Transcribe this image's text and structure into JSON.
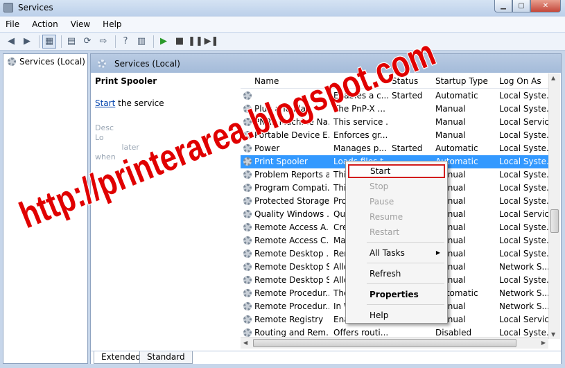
{
  "window": {
    "title": "Services"
  },
  "menu": [
    "File",
    "Action",
    "View",
    "Help"
  ],
  "tree": {
    "root": "Services (Local)"
  },
  "pane": {
    "header": "Services (Local)",
    "selected_service": "Print Spooler",
    "action_link": "Start",
    "action_suffix": " the service",
    "faded_text": "Desc\nLo\n           later\nwhen"
  },
  "columns": [
    "Name",
    "Status",
    "Startup Type",
    "Log On As"
  ],
  "rows": [
    {
      "name": "",
      "desc": "Enables a c...",
      "status": "Started",
      "startup": "Automatic",
      "logon": "Local Syste..."
    },
    {
      "name": "Plug and Play",
      "desc": "The PnP-X ...",
      "status": "",
      "startup": "Manual",
      "logon": "Local Syste..."
    },
    {
      "name": "PNRP Machine Na...",
      "desc": "This service ...",
      "status": "",
      "startup": "Manual",
      "logon": "Local Service"
    },
    {
      "name": "Portable Device E...",
      "desc": "Enforces gr...",
      "status": "",
      "startup": "Manual",
      "logon": "Local Syste..."
    },
    {
      "name": "Power",
      "desc": "Manages p...",
      "status": "Started",
      "startup": "Automatic",
      "logon": "Local Syste..."
    },
    {
      "name": "Print Spooler",
      "desc": "Loads files t...",
      "status": "",
      "startup": "Automatic",
      "logon": "Local Syste..."
    },
    {
      "name": "Problem Reports a...",
      "desc": "This ...",
      "status": "",
      "startup": "Manual",
      "logon": "Local Syste..."
    },
    {
      "name": "Program Compati...",
      "desc": "This ...",
      "status": "",
      "startup": "Manual",
      "logon": "Local Syste..."
    },
    {
      "name": "Protected Storage",
      "desc": "Prov...",
      "status": "",
      "startup": "Manual",
      "logon": "Local Syste..."
    },
    {
      "name": "Quality Windows ...",
      "desc": "Qual...",
      "status": "",
      "startup": "Manual",
      "logon": "Local Service"
    },
    {
      "name": "Remote Access A...",
      "desc": "Crea...",
      "status": "",
      "startup": "Manual",
      "logon": "Local Syste..."
    },
    {
      "name": "Remote Access C...",
      "desc": "Man...",
      "status": "",
      "startup": "Manual",
      "logon": "Local Syste..."
    },
    {
      "name": "Remote Desktop ...",
      "desc": "Rem...",
      "status": "",
      "startup": "Manual",
      "logon": "Local Syste..."
    },
    {
      "name": "Remote Desktop S...",
      "desc": "Allo...",
      "status": "",
      "startup": "Manual",
      "logon": "Network S..."
    },
    {
      "name": "Remote Desktop S...",
      "desc": "Allo...",
      "status": "",
      "startup": "Manual",
      "logon": "Local Syste..."
    },
    {
      "name": "Remote Procedur...",
      "desc": "The ...",
      "status": "",
      "startup": "Automatic",
      "logon": "Network S..."
    },
    {
      "name": "Remote Procedur...",
      "desc": "In W...",
      "status": "",
      "startup": "Manual",
      "logon": "Network S..."
    },
    {
      "name": "Remote Registry",
      "desc": "Enab...",
      "status": "",
      "startup": "Manual",
      "logon": "Local Service"
    },
    {
      "name": "Routing and Rem...",
      "desc": "Offers routi...",
      "status": "",
      "startup": "Disabled",
      "logon": "Local Syste..."
    }
  ],
  "context_menu": {
    "start": "Start",
    "stop": "Stop",
    "pause": "Pause",
    "resume": "Resume",
    "restart": "Restart",
    "all_tasks": "All Tasks",
    "refresh": "Refresh",
    "properties": "Properties",
    "help": "Help"
  },
  "tabs": [
    "Extended",
    "Standard"
  ],
  "watermark": "http://printerarea.blogspot.com",
  "colors": {
    "selection": "#3399ff",
    "highlight_box": "#d21c1c",
    "watermark": "#e00000"
  }
}
